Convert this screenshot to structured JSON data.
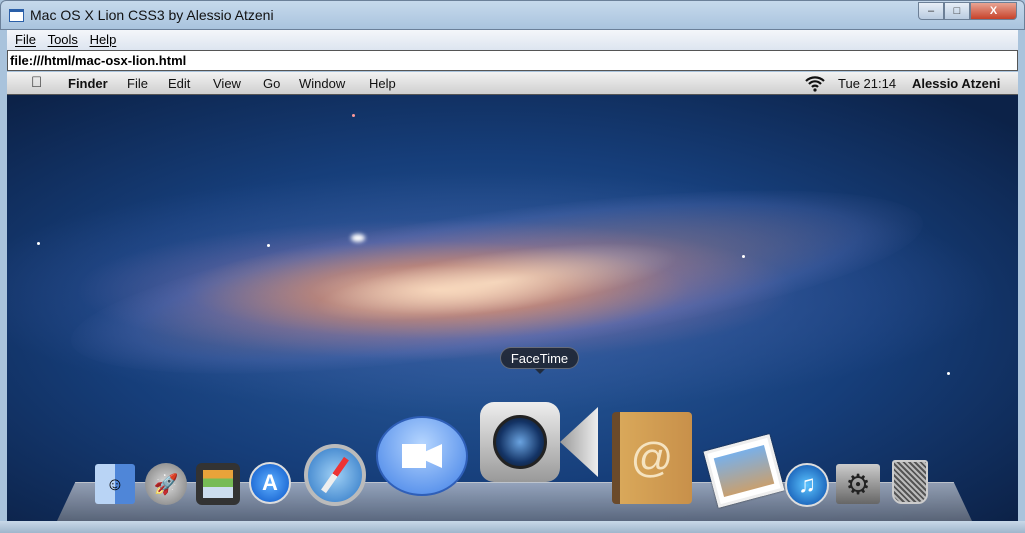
{
  "window": {
    "title": "Mac OS X Lion CSS3 by Alessio Atzeni",
    "minimize": "–",
    "maximize": "□",
    "close": "X"
  },
  "browser_menu": [
    "File",
    "Tools",
    "Help"
  ],
  "address": "file:///html/mac-osx-lion.html",
  "mac_menubar": {
    "app": "Finder",
    "items": [
      "File",
      "Edit",
      "View",
      "Go",
      "Window",
      "Help"
    ],
    "clock": "Tue 21:14",
    "user": "Alessio Atzeni"
  },
  "tooltip": "FaceTime",
  "dock": [
    "Finder",
    "Launchpad",
    "Mission Control",
    "App Store",
    "Safari",
    "iChat",
    "FaceTime",
    "Address Book",
    "iPhoto",
    "iTunes",
    "System Preferences",
    "Trash"
  ]
}
